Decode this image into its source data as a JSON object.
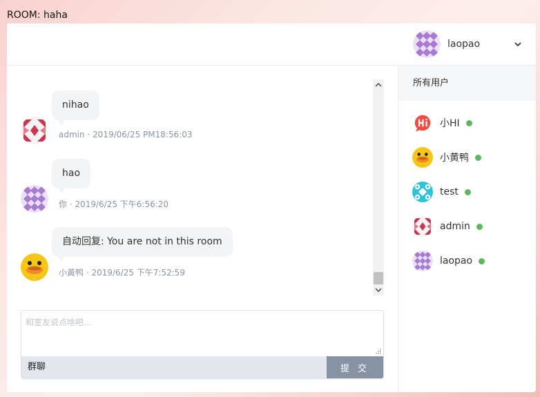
{
  "room": {
    "title": "ROOM: haha"
  },
  "header": {
    "username": "laopao"
  },
  "messages": [
    {
      "text": "nihao",
      "meta": "admin · 2019/06/25 PM18:56:03",
      "avatar": "admin-avatar"
    },
    {
      "text": "hao",
      "meta": "你 · 2019/6/25 下午6:56:20",
      "avatar": "laopao-avatar"
    },
    {
      "text": "自动回复: You are not in this room",
      "meta": "小黃鸭 · 2019/6/25 下午7:52:59",
      "avatar": "duck-avatar"
    }
  ],
  "composer": {
    "placeholder": "和室友说点啥吧...",
    "mode_label": "群聊",
    "submit_label": "提 交"
  },
  "sidebar": {
    "title": "所有用户",
    "users": [
      {
        "name": "小HI",
        "status": "online",
        "avatar": "hi-avatar"
      },
      {
        "name": "小黄鸭",
        "status": "online",
        "avatar": "duck-avatar"
      },
      {
        "name": "test",
        "status": "online",
        "avatar": "test-avatar"
      },
      {
        "name": "admin",
        "status": "online",
        "avatar": "admin-avatar"
      },
      {
        "name": "laopao",
        "status": "online",
        "avatar": "laopao-avatar"
      }
    ]
  },
  "colors": {
    "online_dot": "#5cb85c",
    "bubble_bg": "#f3f4f6",
    "submit_bg": "#8792a5",
    "admin_avatar": "#c8374f",
    "laopao_avatar": "#a67bd1",
    "test_avatar": "#2bc4d8",
    "duck_avatar": "#f5c518",
    "hi_avatar": "#ef4b3f"
  }
}
